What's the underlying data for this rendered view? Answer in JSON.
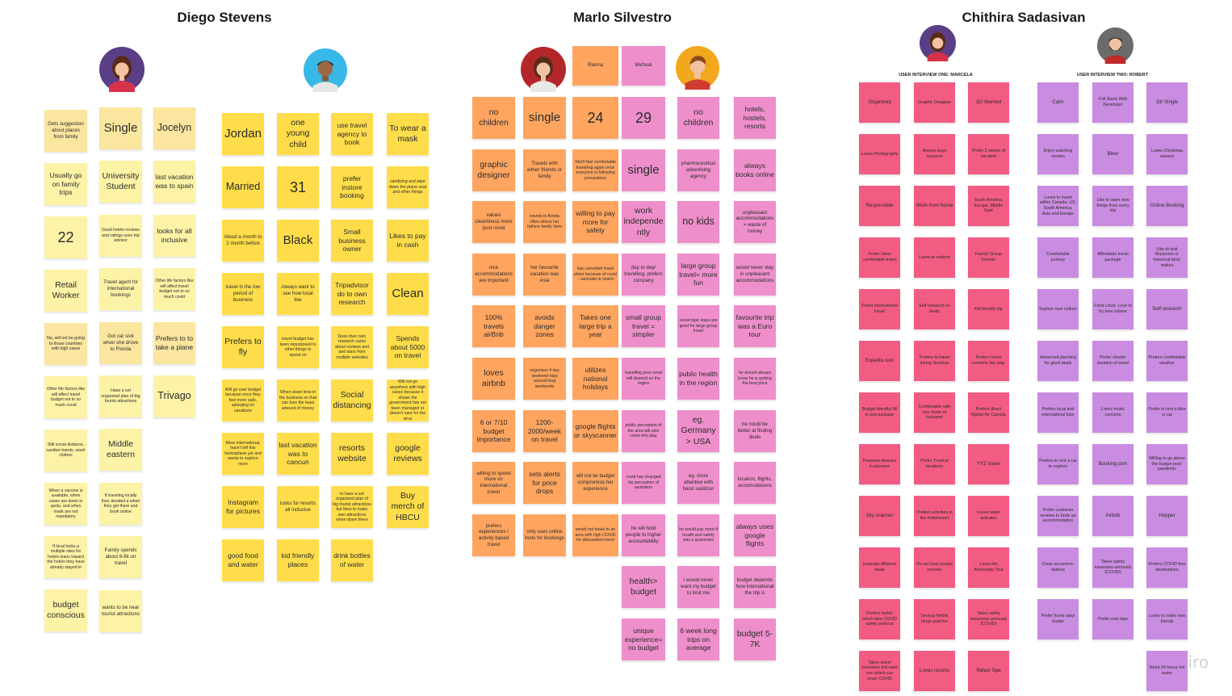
{
  "board": {
    "brand_watermark": "miro",
    "colors": {
      "diego": "#fdf3a6",
      "diego_tall": "#fbe6a0",
      "jordan": "#ffdd4a",
      "marlo_orange": "#ffa55f",
      "marlo_pink": "#ee8fcb",
      "chithira_red": "#f25c83",
      "chithira_purple": "#ca8ce0"
    }
  },
  "personas": [
    {
      "name": "Diego Stevens"
    },
    {
      "name": "Marlo Silvestro"
    },
    {
      "name": "Chithira Sadasivan",
      "interview_one": "USER INTERVIEW ONE: MARCELA",
      "interview_two": "USER INTERVIEW TWO: ROBERT"
    }
  ],
  "header_stickies": {
    "rianna": "Rianna",
    "micheal": "Micheal"
  },
  "columns": {
    "d1": [
      "Gets suggestion about places from family",
      "Usually go on family trips",
      "22",
      "Retail Worker",
      "No, will not be going to those countries with high cases",
      "Other life factors like will affect travel budget not to so much covid",
      "Still social distance, sanitize hands, wash clothes",
      "When a vaccine is available, when cases are down in spots, and when mask are not mandatory",
      "If local looks a multiple sites for hotels leans toward the hotels they have already stayed in",
      "budget conscious"
    ],
    "d2": [
      "Single",
      "University Student",
      "Good hotels reviews and ratings uses trip advisor",
      "Travel agent for international bookings",
      "Got car sick when she drove to Florida",
      "Have a set organized plan of big tourist attractions",
      "Middle eastern",
      "If traveling locally they decided a when they get there and book online",
      "Family spends about 6-8k on travel",
      "wants to be near tourist attractions"
    ],
    "d3": [
      "Jocelyn",
      "last vacation was to spain",
      "looks for all inclusive",
      "Other life factors like will affect travel budget not to so much covid",
      "Prefers to to take a plane",
      "Trivago"
    ],
    "j1": [
      "Jordan",
      "Married",
      "About a month to 2 month before",
      "travel in the low period of business",
      "Prefers to fly",
      "Will go over budget because once they feel more safe, splurging on vacations",
      "More international, hasn't left this hemisphere yet and wants to explore more",
      "Instagram for pictures",
      "good food and water"
    ],
    "j2": [
      "one young child",
      "31",
      "Black",
      "Always want to see how local live",
      "travel budget has been repurposed to other things to spend on",
      "When down time in the business so that can lose the least amount of money",
      "last vacation was to cancun",
      "looks for resorts all inclusive",
      "kid friendly places"
    ],
    "j3": [
      "use travel agency to book",
      "prefer instore booking",
      "Small business owner",
      "Tripadvisor do to own research",
      "Does their own research cares about reviews and and stars from multiple websites",
      "Social distancing",
      "resorts website",
      "to have a set organized plan of big tourist attractions but likes to make own attractions when down there",
      "drink bottles of water"
    ],
    "j4": [
      "To wear a mask",
      "sanitizing and wipe down the plane seat and other things",
      "Likes to pay in cash",
      "Clean",
      "Spends about 5000 on travel",
      "Will not go anywhere with high cases because it shows the government has not been managed or doesn't care for the virus",
      "google reviews",
      "Buy merch of HBCU"
    ],
    "m1": [
      "no children",
      "graphic designer",
      "values cleanliness more post covid",
      "nice accommodations are important",
      "100% travels airBnb",
      "loves airbnb",
      "6 or 7/10 budget importance",
      "willing to spend more on international travel",
      "prefers experiences / activity based travel"
    ],
    "m2": [
      "single",
      "Travels with either friends or family",
      "travels to florida often where her fathers family lives",
      "her favourite vacation was Asia",
      "avoids danger zones",
      "organizes 4 day weekend trips around long weekends",
      "1200-2000/week on travel",
      "sets alerts for price drops",
      "only uses online tools for bookings"
    ],
    "m3": [
      "24",
      "She'll feel comfortable travelling again once everyone is following precautions",
      "willing to pay more for safety",
      "has cancelled travel plans because of covid - carnivale in miami",
      "Takes one large trip a year",
      "utilizes national holidays",
      "google flights or skyscanner",
      "will not let budget compromise her experience",
      "would not travel to an area with high COVID for discounted travel"
    ],
    "m4": [
      "29",
      "single",
      "work independently",
      "day to day/ travelling, prefers company",
      "small group travel = simpler",
      "travelling post covid will depend on the region",
      "public perception of the area will also come into play",
      "covid has changed his perception of sanitation",
      "he will hold people to higher accountability",
      "health> budget",
      "unique experience= no budget"
    ],
    "m5": [
      "no children",
      "pharmaceutical advertising agency",
      "no kids",
      "large group travel= more fun",
      "resort type stays are good for large group travel",
      "public health in the region",
      "eg. Germany> USA",
      "eg. more attentive with hand sanitizer",
      "he would pay more if health and safety was a guarantee",
      "I would never want my budget to limit me",
      "6 week long trips on average"
    ],
    "m6": [
      "hotels, hostels, resorts",
      "always books online",
      "unpleasant accommodations = waste of money",
      "would never stay in unpleasant accommodations",
      "favourite trip was a Euro tour",
      "he doesnt always know he is getting the best price",
      "he could be better at finding deals",
      "location, flights, accomodations",
      "always uses google flights",
      "budget depends how international the trip is",
      "budget 5-7K"
    ],
    "c1": [
      "Organized",
      "Loves Photography",
      "Responsible",
      "Prefer clean comfortable travel",
      "Prefer international travel",
      "Expedia.com",
      "Budget friendly/ All in one package",
      "Prepares itinerary in advance",
      "Sky scanner",
      "Evaluate different deals",
      "Prefers hotels which take COVID safety protocol",
      "Takes travel insurance but want one which can cover COVID"
    ],
    "c2": [
      "Graphic Designer",
      "Always buys souvenir",
      "Work from home",
      "Loves to explore",
      "Self research on deals",
      "Prefers to travel during Summer",
      "Comfortable with any mode of transport",
      "Prefer Tropical locations",
      "Prefers activities in the hotel/resort",
      "Do not trust google reviews",
      "Serious Netflix binge watcher",
      "Loves resorts"
    ],
    "c3": [
      "32/ Married",
      "Prefer 2 weeks of vacation",
      "South America, Europe, Middle East",
      "Family/ Group traveler",
      "Kid friendly trip",
      "Prefers home comforts like stay.",
      "Prefers direct flights/ Air Canada",
      "YYZ travel",
      "Loves water activates",
      "Loves Art Aficionado Tour",
      "Takes safety measures seriously (COVID)",
      "Relax/ Spa"
    ],
    "r1": [
      "Calm",
      "Enjoy watching movies",
      "Loves to travel within Canada, US, South America, Asia and Europe",
      "Comfortable journey",
      "Explore new culture",
      "Advanced planning for good deals",
      "Prefers local and international trips",
      "Prefers to rent a car to explore",
      "Prefer customer reviews to book an accommodation",
      "Clean accommo- dations",
      "Prefer home stay/ hostel"
    ],
    "r2": [
      "Full Stack Web Developer",
      "Biker",
      "Like to learn new things from every trip",
      "Affordable travel package",
      "Food Lover. Love to try new cuisine",
      "Prefer shorter duration of travel",
      "Loves music concerts",
      "Booking.com",
      "Airbnb",
      "Takes safety measures seriously (COVID)",
      "Prefer solo trips"
    ],
    "r3": [
      "33/ Single",
      "Loves Christmas season",
      "Online Booking",
      "Like to visit Museums or historical land-makes",
      "Self research",
      "Prefers comfortable weather",
      "Prefer to rent a bike or car",
      "Willing to go above the budget post-pandemic",
      "Hopper",
      "Prefers COVID free destinations",
      "Loves to make new friends",
      "Need 24 hours hot water"
    ]
  }
}
